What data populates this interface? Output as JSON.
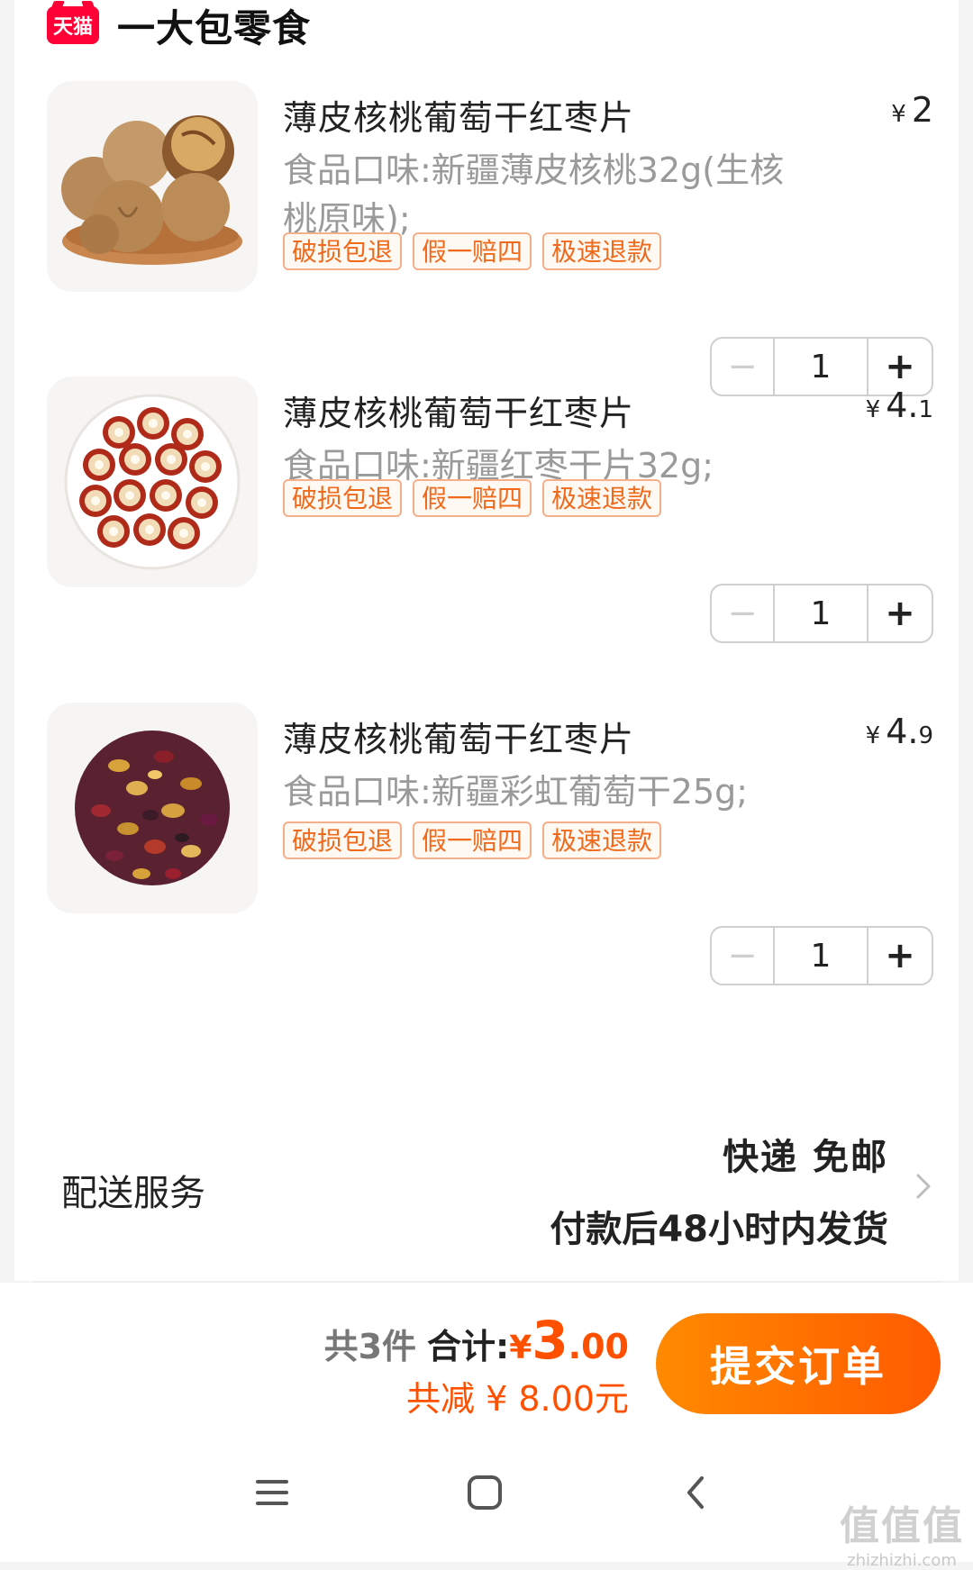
{
  "shop": {
    "logo_text": "天猫",
    "name": "一大包零食"
  },
  "items": [
    {
      "title": "薄皮核桃葡萄干红枣片",
      "price_yen": "¥",
      "price_int": "2",
      "price_dec": "",
      "sku": "食品口味:新疆薄皮核桃32g(生核桃原味);",
      "tags": [
        "破损包退",
        "假一赔四",
        "极速退款"
      ],
      "qty": "1",
      "image": "walnuts"
    },
    {
      "title": "薄皮核桃葡萄干红枣片",
      "price_yen": "¥",
      "price_int": "4.",
      "price_dec": "1",
      "sku": "食品口味:新疆红枣干片32g;",
      "tags": [
        "破损包退",
        "假一赔四",
        "极速退款"
      ],
      "qty": "1",
      "image": "jujube-slices"
    },
    {
      "title": "薄皮核桃葡萄干红枣片",
      "price_yen": "¥",
      "price_int": "4.",
      "price_dec": "9",
      "sku": "食品口味:新疆彩虹葡萄干25g;",
      "tags": [
        "破损包退",
        "假一赔四",
        "极速退款"
      ],
      "qty": "1",
      "image": "raisins"
    }
  ],
  "stepper": {
    "minus": "−",
    "plus": "+"
  },
  "delivery": {
    "label": "配送服务",
    "method": "快递 免邮",
    "ship_time": "付款后48小时内发货"
  },
  "summary": {
    "count": "共3件",
    "total_label": "合计:",
    "total_yen": "¥",
    "total_int": "3",
    "total_dec": ".00",
    "discount": "共减 ¥ 8.00元"
  },
  "submit_label": "提交订单",
  "nav": {
    "menu": "menu-icon",
    "home": "home-icon",
    "back": "back-icon"
  },
  "watermark": {
    "big": "值值值",
    "small": "zhizhizhi.com"
  },
  "colors": {
    "accent": "#ff5000",
    "button_start": "#ff8a00",
    "button_end": "#ff5a00",
    "tag_border": "#f5b08a",
    "tmall": "#ff0036"
  }
}
